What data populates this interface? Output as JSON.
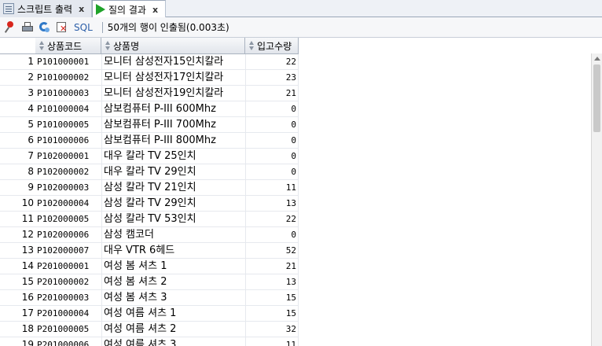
{
  "tabs": [
    {
      "label": "스크립트 출력",
      "close": "x",
      "icon": "script-output-icon",
      "active": false
    },
    {
      "label": "질의 결과",
      "close": "x",
      "icon": "run-query-icon",
      "active": true
    }
  ],
  "toolbar": {
    "sql_label": "SQL",
    "status": "50개의 행이 인출됨(0.003초)"
  },
  "table": {
    "columns": [
      "상품코드",
      "상품명",
      "입고수량"
    ],
    "rows": [
      {
        "num": "1",
        "code": "P101000001",
        "name": "모니터 삼성전자15인치칼라",
        "qty": "22"
      },
      {
        "num": "2",
        "code": "P101000002",
        "name": "모니터 삼성전자17인치칼라",
        "qty": "23"
      },
      {
        "num": "3",
        "code": "P101000003",
        "name": "모니터 삼성전자19인치칼라",
        "qty": "21"
      },
      {
        "num": "4",
        "code": "P101000004",
        "name": "삼보컴퓨터 P-III 600Mhz",
        "qty": "0"
      },
      {
        "num": "5",
        "code": "P101000005",
        "name": "삼보컴퓨터 P-III 700Mhz",
        "qty": "0"
      },
      {
        "num": "6",
        "code": "P101000006",
        "name": "삼보컴퓨터 P-III 800Mhz",
        "qty": "0"
      },
      {
        "num": "7",
        "code": "P102000001",
        "name": "대우 칼라 TV 25인치",
        "qty": "0"
      },
      {
        "num": "8",
        "code": "P102000002",
        "name": "대우 칼라 TV 29인치",
        "qty": "0"
      },
      {
        "num": "9",
        "code": "P102000003",
        "name": "삼성 칼라 TV 21인치",
        "qty": "11"
      },
      {
        "num": "10",
        "code": "P102000004",
        "name": "삼성 칼라 TV 29인치",
        "qty": "13"
      },
      {
        "num": "11",
        "code": "P102000005",
        "name": "삼성 칼라 TV 53인치",
        "qty": "22"
      },
      {
        "num": "12",
        "code": "P102000006",
        "name": "삼성 캠코더",
        "qty": "0"
      },
      {
        "num": "13",
        "code": "P102000007",
        "name": "대우 VTR 6헤드",
        "qty": "52"
      },
      {
        "num": "14",
        "code": "P201000001",
        "name": "여성 봄 셔츠 1",
        "qty": "21"
      },
      {
        "num": "15",
        "code": "P201000002",
        "name": "여성 봄 셔츠 2",
        "qty": "13"
      },
      {
        "num": "16",
        "code": "P201000003",
        "name": "여성 봄 셔츠 3",
        "qty": "15"
      },
      {
        "num": "17",
        "code": "P201000004",
        "name": "여성 여름 셔츠 1",
        "qty": "15"
      },
      {
        "num": "18",
        "code": "P201000005",
        "name": "여성 여름 셔츠 2",
        "qty": "32"
      },
      {
        "num": "19",
        "code": "P201000006",
        "name": "여성 여름 셔츠 3",
        "qty": "11"
      }
    ]
  }
}
